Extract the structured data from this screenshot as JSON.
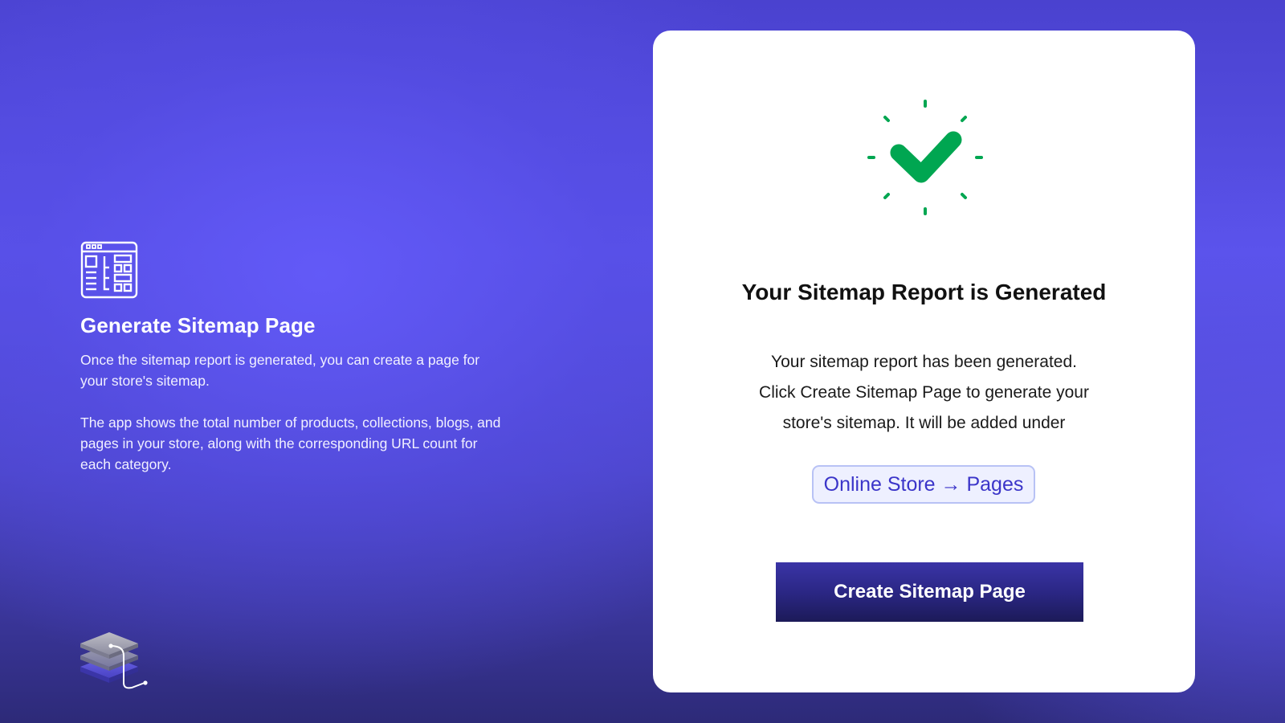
{
  "colors": {
    "accent": "#5b54f0",
    "success": "#00a651",
    "primary_button": "#2b2785",
    "chip_text": "#3b35c9",
    "card_background": "#ffffff"
  },
  "feature": {
    "icon": "sitemap-layout-icon",
    "title": "Generate Sitemap Page",
    "paragraph_1": "Once the sitemap report is generated, you can create a page for your store's sitemap.",
    "paragraph_2": "The app shows the total number of products, collections, blogs, and pages in your store, along with the corresponding URL count for each category."
  },
  "brand": {
    "icon": "layered-stack-logo-icon"
  },
  "card": {
    "icon": "success-checkmark-icon",
    "title": "Your Sitemap Report is Generated",
    "body_lines": [
      "Your sitemap report has been generated.",
      "Click Create Sitemap Page to generate your",
      "store's sitemap. It will be added under"
    ],
    "path_chip": "Online Store → Pages",
    "button_label": "Create Sitemap Page"
  }
}
